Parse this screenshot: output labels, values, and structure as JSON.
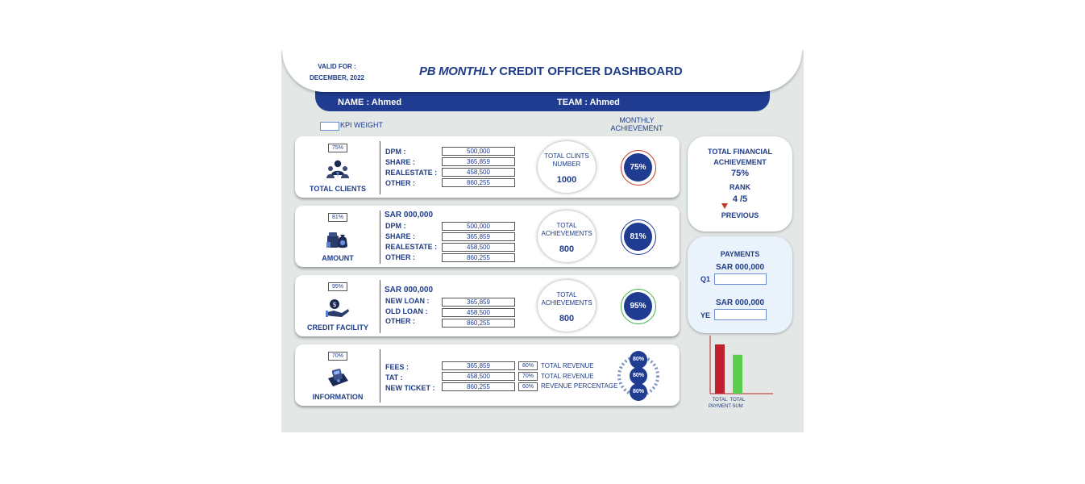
{
  "header": {
    "valid_for_label": "VALID FOR :",
    "valid_for_date": "DECEMBER, 2022",
    "title_bold": "PB MONTHLY",
    "title_rest": "CREDIT OFFICER DASHBOARD",
    "name": "NAME : Ahmed",
    "team": "TEAM : Ahmed"
  },
  "labels": {
    "kpi_weight": "KPI WEIGHT",
    "monthly_line1": "MONTHLY",
    "monthly_line2": "ACHIEVEMENT",
    "sar_unit": "SAR 000,000"
  },
  "cards": {
    "clients": {
      "weight": "75%",
      "label": "TOTAL CLIENTS",
      "icon": "people-icon",
      "rows": [
        {
          "label": "DPM :",
          "value": "500,000"
        },
        {
          "label": "SHARE :",
          "value": "365,859"
        },
        {
          "label": "REALESTATE :",
          "value": "458,500"
        },
        {
          "label": "OTHER :",
          "value": "860,255"
        }
      ],
      "pill_title_1": "TOTAL CLINTS",
      "pill_title_2": "NUMBER",
      "pill_value": "1000",
      "achievement": "75%",
      "ring_color": "#c0392b"
    },
    "amount": {
      "weight": "81%",
      "label": "AMOUNT",
      "icon": "money-bag-icon",
      "rows": [
        {
          "label": "DPM :",
          "value": "500,000"
        },
        {
          "label": "SHARE :",
          "value": "365,859"
        },
        {
          "label": "REALESTATE :",
          "value": "458,500"
        },
        {
          "label": "OTHER :",
          "value": "860,255"
        }
      ],
      "pill_title_1": "TOTAL",
      "pill_title_2": "ACHIEVEMENTS",
      "pill_value": "800",
      "achievement": "81%",
      "ring_color": "#1f3c91"
    },
    "credit": {
      "weight": "95%",
      "label": "CREDIT FACILITY",
      "icon": "money-hand-icon",
      "rows": [
        {
          "label": "NEW LOAN :",
          "value": "365,859"
        },
        {
          "label": "OLD LOAN :",
          "value": "458,500"
        },
        {
          "label": "OTHER :",
          "value": "860,255"
        }
      ],
      "pill_title_1": "TOTAL",
      "pill_title_2": "ACHIEVEMENTS",
      "pill_value": "800",
      "achievement": "95%",
      "ring_color": "#3cb043"
    },
    "info": {
      "weight": "70%",
      "label": "INFORMATION",
      "icon": "pos-terminal-icon",
      "rows": [
        {
          "label": "FEES :",
          "value": "365,859",
          "pct": "80%",
          "desc": "TOTAL REVENUE"
        },
        {
          "label": "TAT :",
          "value": "458,500",
          "pct": "70%",
          "desc": "TOTAL REVENUE"
        },
        {
          "label": "NEW TICKET :",
          "value": "860,255",
          "pct": "60%",
          "desc": "REVENUE PERCENTAGE"
        }
      ],
      "wheel": [
        "80%",
        "80%",
        "80%"
      ]
    }
  },
  "summary": {
    "line1": "TOTAL FINANCIAL",
    "line2": "ACHIEVEMENT",
    "value": "75%",
    "rank_label": "RANK",
    "rank": "4 /5",
    "previous": "PREVIOUS"
  },
  "payments": {
    "title": "PAYMENTS",
    "unit_q1": "SAR 000,000",
    "q1_label": "Q1",
    "unit_ye": "SAR 000,000",
    "ye_label": "YE"
  },
  "chart_data": {
    "type": "bar",
    "categories": [
      "TOTAL PAYMENT",
      "TOTAL SUM"
    ],
    "cat_lines": [
      [
        "TOTAL",
        "PAYMENT"
      ],
      [
        "TOTAL",
        "SUM"
      ]
    ],
    "values": [
      100,
      79
    ],
    "ylim": [
      0,
      118
    ],
    "colors": [
      "#c0202e",
      "#5ccd4e"
    ],
    "axis_color": "#c0202e",
    "grid": false,
    "title": "",
    "xlabel": "",
    "ylabel": ""
  }
}
